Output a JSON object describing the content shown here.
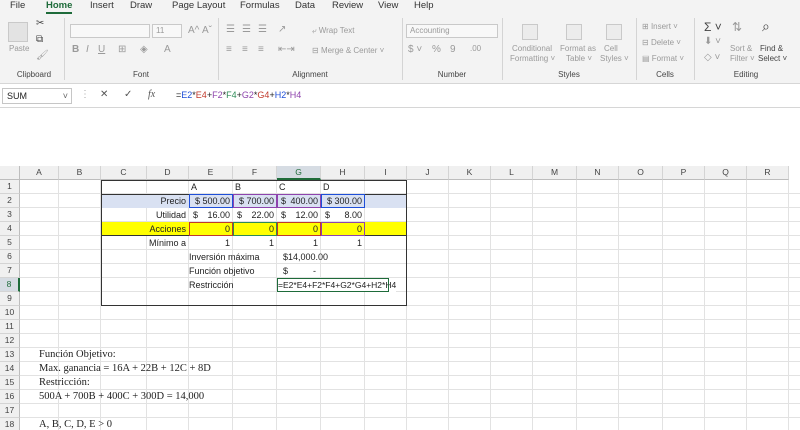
{
  "ribbon_tabs": [
    "File",
    "Home",
    "Insert",
    "Draw",
    "Page Layout",
    "Formulas",
    "Data",
    "Review",
    "View",
    "Help"
  ],
  "active_tab": "Home",
  "clipboard": {
    "paste": "Paste",
    "label": "Clipboard"
  },
  "font": {
    "name": "",
    "size": "11",
    "label": "Font"
  },
  "alignment": {
    "wrap_text": "Wrap Text",
    "merge_center": "Merge & Center",
    "label": "Alignment"
  },
  "number": {
    "format": "Accounting",
    "label": "Number"
  },
  "styles": {
    "conditional": "Conditional",
    "formatting": "Formatting",
    "format_as": "Format as",
    "table": "Table",
    "cell": "Cell",
    "cell_styles": "Styles",
    "label": "Styles"
  },
  "cells": {
    "insert": "Insert",
    "delete": "Delete",
    "format": "Format",
    "label": "Cells"
  },
  "editing": {
    "sort": "Sort &",
    "filter": "Filter",
    "find": "Find &",
    "select": "Select",
    "label": "Editing"
  },
  "formula_bar": {
    "name_box": "SUM",
    "formula": "=E2*E4+F2*F4+G2*G4+H2*H4"
  },
  "columns": [
    "A",
    "B",
    "C",
    "D",
    "E",
    "F",
    "G",
    "H",
    "I",
    "J",
    "K",
    "L",
    "M",
    "N",
    "O",
    "P",
    "Q",
    "R"
  ],
  "rows": [
    "1",
    "2",
    "3",
    "4",
    "5",
    "6",
    "7",
    "8",
    "9",
    "10",
    "11",
    "12",
    "13",
    "14",
    "15",
    "16",
    "17",
    "18"
  ],
  "sheet": {
    "headers": {
      "a": "A",
      "b": "B",
      "c": "C",
      "d": "D"
    },
    "precio": {
      "label": "Precio",
      "e": "$ 500.00",
      "f": "$ 700.00",
      "g_sym": "$",
      "g": "400.00",
      "h": "$ 300.00"
    },
    "utilidad": {
      "label": "Utilidad",
      "e_sym": "$",
      "e": "16.00",
      "f_sym": "$",
      "f": "22.00",
      "g_sym": "$",
      "g": "12.00",
      "h_sym": "$",
      "h": "8.00"
    },
    "acciones": {
      "label": "Acciones",
      "e": "0",
      "f": "0",
      "g": "0",
      "h": "0"
    },
    "minimo": {
      "label": "Mínimo a",
      "e": "1",
      "f": "1",
      "g": "1",
      "h": "1"
    },
    "inversion": {
      "label": "Inversión máxima",
      "value": "$14,000.00"
    },
    "funcion": {
      "label": "Función objetivo",
      "sym": "$",
      "value": "-"
    },
    "restriccion": {
      "label": "Restricción",
      "value": "=E2*E4+F2*F4+G2*G4+H2*H4"
    },
    "text13": "Función Objetivo:",
    "text14": "Max. ganancia = 16A + 22B + 12C + 8D",
    "text15": "Restricción:",
    "text16": "500A + 700B + 400C + 300D  = 14,000",
    "text18": "A, B, C, D, E > 0"
  },
  "colors": {
    "accent": "#1e6b3a",
    "precio_row": "#d9e1f2",
    "acciones_row": "#ffff00"
  }
}
